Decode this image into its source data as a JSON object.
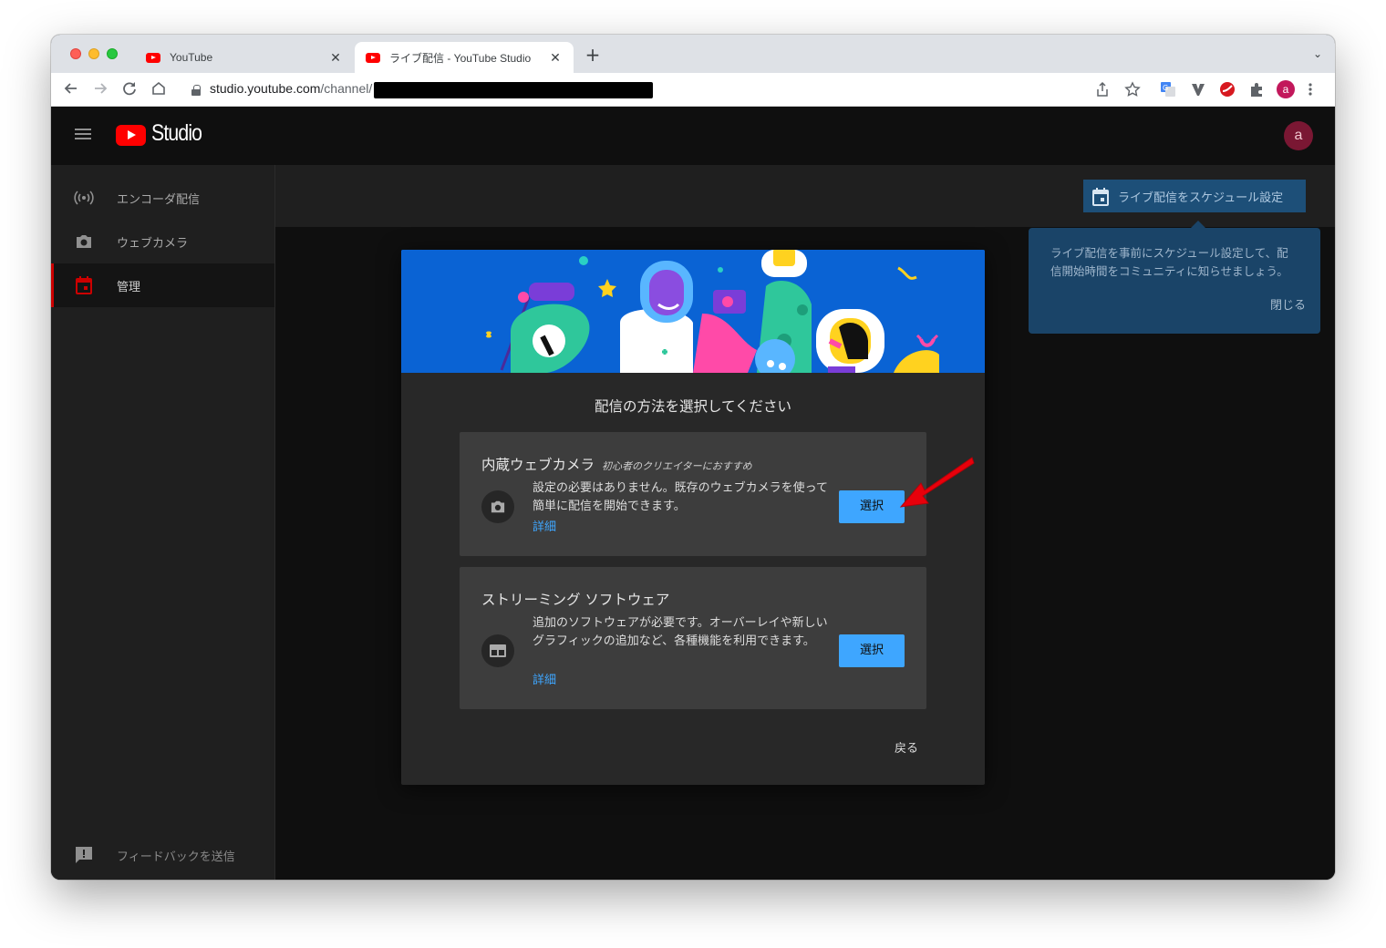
{
  "browser": {
    "tabs": [
      {
        "title": "YouTube",
        "close": "✕"
      },
      {
        "title": "ライブ配信 - YouTube Studio",
        "close": "✕"
      }
    ],
    "new_tab": "+",
    "tab_search": "⌄",
    "url_host": "studio.youtube.com",
    "url_path": "/channel/",
    "avatar_letter": "a"
  },
  "studio": {
    "logo_text": "Studio",
    "avatar_letter": "a",
    "sidebar": [
      {
        "label": "エンコーダ配信",
        "icon": "broadcast-icon"
      },
      {
        "label": "ウェブカメラ",
        "icon": "camera-icon"
      },
      {
        "label": "管理",
        "icon": "calendar-icon",
        "active": true
      }
    ],
    "feedback_label": "フィードバックを送信",
    "schedule_button": "ライブ配信をスケジュール設定",
    "tooltip": {
      "text": "ライブ配信を事前にスケジュール設定して、配信開始時間をコミュニティに知らせましょう。",
      "close": "閉じる"
    }
  },
  "modal": {
    "title": "配信の方法を選択してください",
    "options": [
      {
        "title": "内蔵ウェブカメラ",
        "subtitle": "初心者のクリエイターにおすすめ",
        "description": "設定の必要はありません。既存のウェブカメラを使って簡単に配信を開始できます。",
        "link": "詳細",
        "button": "選択",
        "icon": "camera-icon"
      },
      {
        "title": "ストリーミング ソフトウェア",
        "subtitle": "",
        "description": "追加のソフトウェアが必要です。オーバーレイや新しいグラフィックの追加など、各種機能を利用できます。",
        "link": "詳細",
        "button": "選択",
        "icon": "software-icon"
      }
    ],
    "back": "戻る"
  },
  "colors": {
    "accent": "#3ea6ff",
    "brand_red": "#ff0000",
    "annotation_arrow": "#e8000b"
  }
}
